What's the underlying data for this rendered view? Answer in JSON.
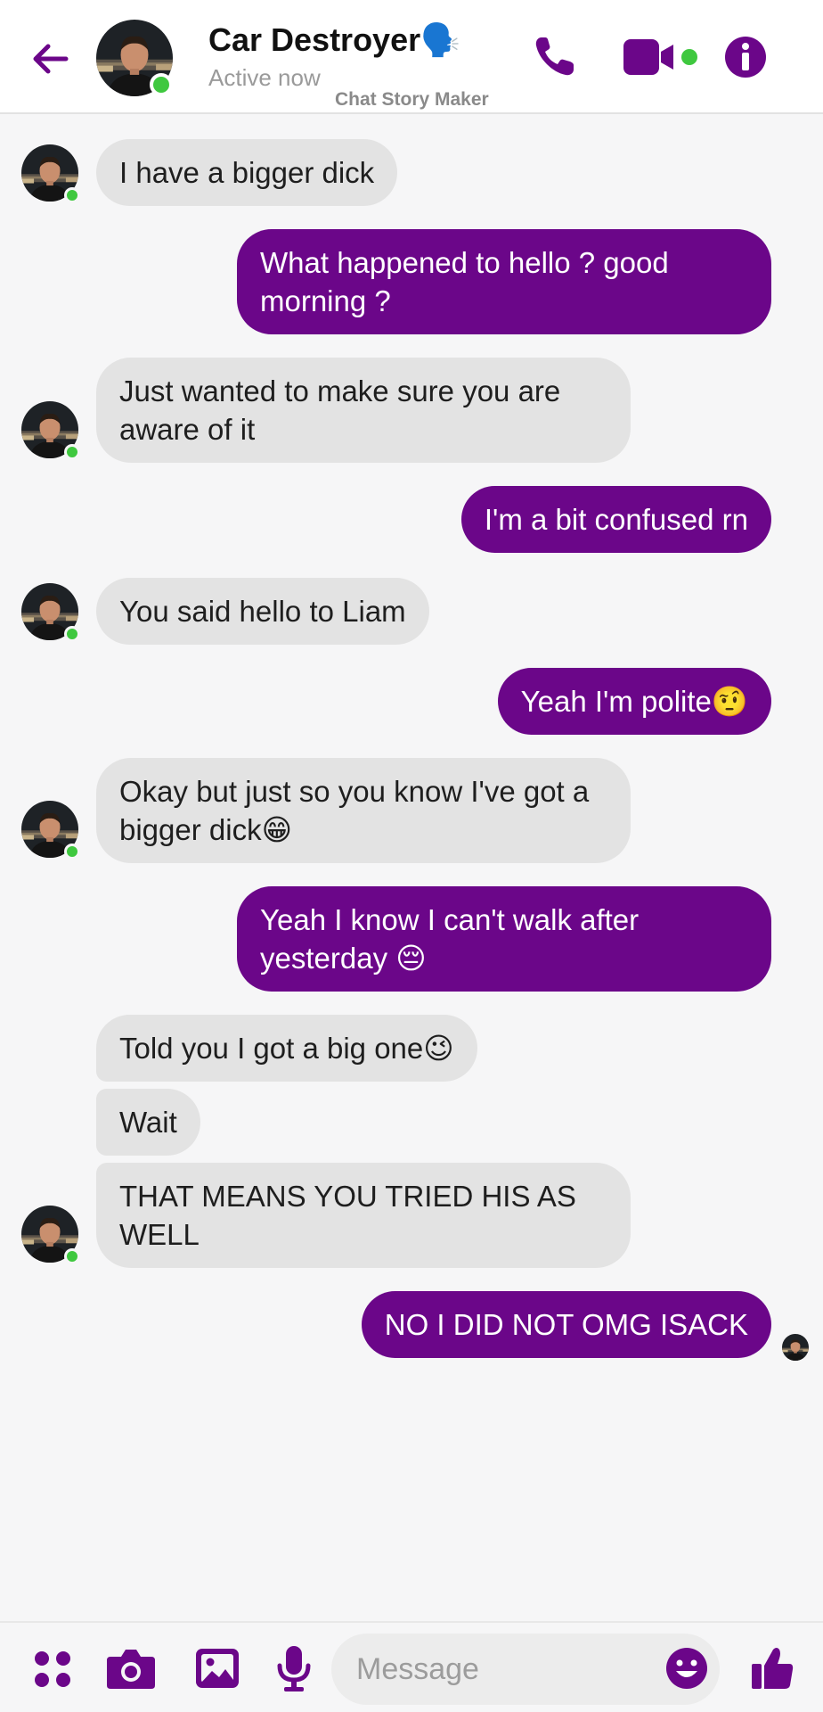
{
  "header": {
    "contact_name": "Car Destroyer🗣️",
    "status": "Active now",
    "watermark": "Chat Story Maker"
  },
  "colors": {
    "accent": "#6b0689",
    "online": "#3fc83f",
    "incoming_bubble": "#e3e3e3"
  },
  "icons": [
    "back-arrow-icon",
    "phone-icon",
    "video-camera-icon",
    "info-icon",
    "apps-grid-icon",
    "camera-icon",
    "image-icon",
    "microphone-icon",
    "emoji-icon",
    "thumbs-up-icon"
  ],
  "messages": [
    {
      "side": "incoming",
      "text": "I have a bigger dick"
    },
    {
      "side": "outgoing",
      "text": "What happened to hello ? good morning ?"
    },
    {
      "side": "incoming",
      "text": "Just wanted to make sure you are aware of it"
    },
    {
      "side": "outgoing",
      "text": "I'm a bit confused rn"
    },
    {
      "side": "incoming",
      "text": "You said hello to Liam"
    },
    {
      "side": "outgoing",
      "text": "Yeah I'm polite🤨"
    },
    {
      "side": "incoming",
      "text": "Okay but just so you know I've got a bigger dick😁"
    },
    {
      "side": "outgoing",
      "text": "Yeah I know I can't walk after yesterday 😔"
    },
    {
      "side": "incoming",
      "text": "Told you I got a big one😉"
    },
    {
      "side": "incoming",
      "text": "Wait"
    },
    {
      "side": "incoming",
      "text": "THAT MEANS YOU TRIED HIS AS WELL"
    },
    {
      "side": "outgoing",
      "text": "NO I DID NOT OMG ISACK"
    }
  ],
  "composer": {
    "placeholder": "Message"
  }
}
